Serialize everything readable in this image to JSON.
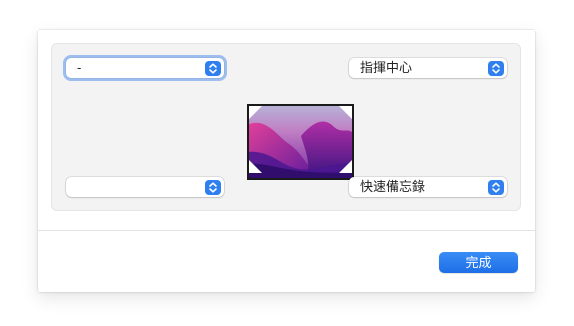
{
  "hot_corners": {
    "top_left": {
      "value": "-"
    },
    "top_right": {
      "value": "指揮中心"
    },
    "bottom_left": {
      "value": ""
    },
    "bottom_right": {
      "value": "快速備忘錄"
    }
  },
  "footer": {
    "done_label": "完成"
  },
  "colors": {
    "accent": "#2f7ff0",
    "panel_bg": "#f3f3f3"
  },
  "icons": {
    "popup_stepper": "chevron-up-down-icon",
    "corner_marker": "corner-triangle-icon"
  }
}
